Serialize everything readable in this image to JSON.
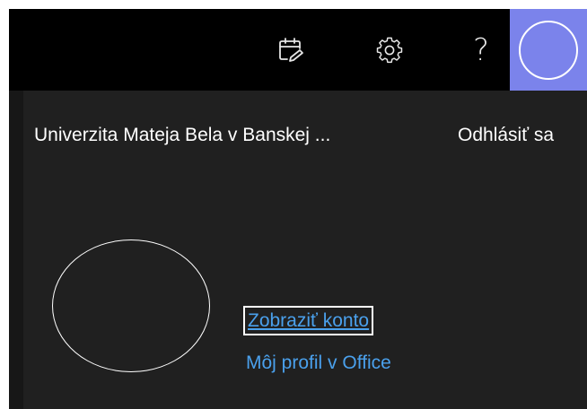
{
  "header": {
    "icons": [
      {
        "name": "tasks-icon"
      },
      {
        "name": "gear-icon"
      },
      {
        "name": "help-icon",
        "glyph": "?"
      }
    ],
    "avatar_color": "#7b83eb"
  },
  "account_panel": {
    "organization": "Univerzita Mateja Bela v Banskej ...",
    "sign_out_label": "Odhlásiť sa",
    "view_account_label": "Zobraziť konto",
    "office_profile_label": "Môj profil v Office"
  },
  "colors": {
    "topbar_bg": "#000000",
    "panel_bg": "#202020",
    "link": "#4aa0ec",
    "text": "#ffffff"
  }
}
